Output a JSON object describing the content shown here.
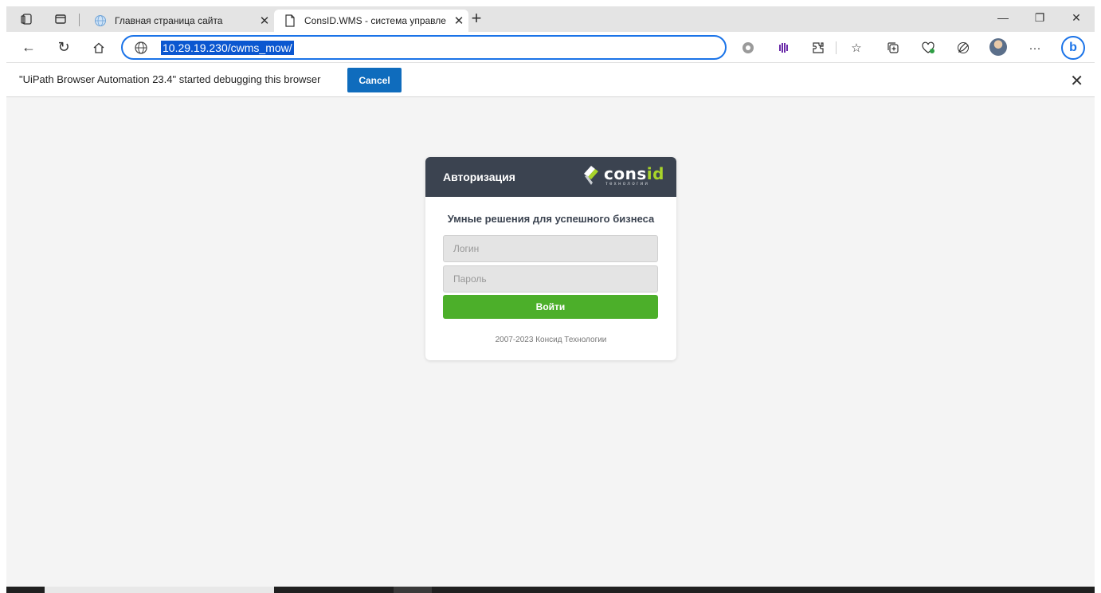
{
  "browser": {
    "tabs": [
      {
        "label": "Главная страница сайта",
        "icon": "globe-icon",
        "active": false
      },
      {
        "label": "ConsID.WMS - система управле",
        "icon": "page-icon",
        "active": true
      }
    ],
    "new_tab_label": "+",
    "window": {
      "minimize": "—",
      "restore": "❐",
      "close": "✕"
    },
    "address": "10.29.19.230/cwms_mow/",
    "more_label": "···"
  },
  "infobar": {
    "message": "\"UiPath Browser Automation 23.4\" started debugging this browser",
    "cancel_label": "Cancel",
    "close_label": "✕"
  },
  "login": {
    "header_title": "Авторизация",
    "logo_text_1": "cons",
    "logo_text_2": "id",
    "logo_sub": "технологии",
    "subtitle": "Умные решения для успешного бизнеса",
    "login_placeholder": "Логин",
    "password_placeholder": "Пароль",
    "submit_label": "Войти",
    "copyright": "2007-2023 Консид Технологии"
  },
  "colors": {
    "header_bg": "#3b4350",
    "accent_green": "#4caf2a",
    "logo_green": "#a8d42a",
    "cancel_blue": "#0f6cbd",
    "url_highlight": "#0b57d0"
  }
}
